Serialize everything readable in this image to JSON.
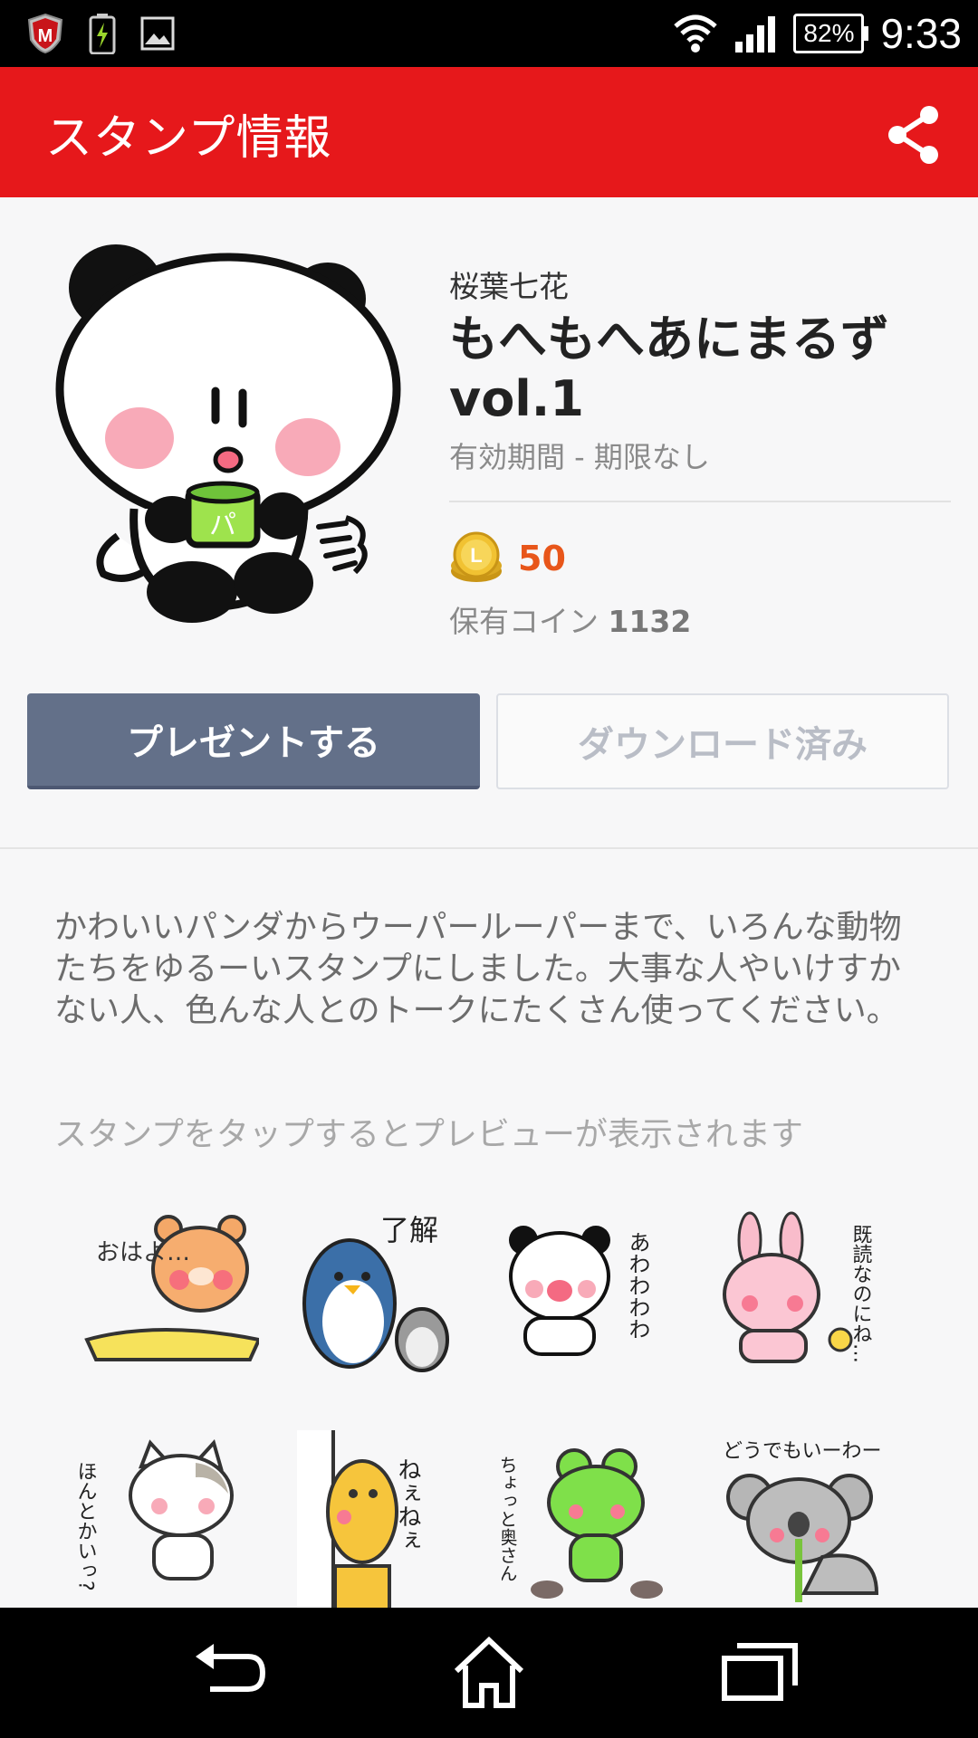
{
  "status_bar": {
    "battery": "82%",
    "time": "9:33"
  },
  "app_bar": {
    "title": "スタンプ情報",
    "share_icon": "share-icon"
  },
  "pack": {
    "author": "桜葉七花",
    "title": "もへもへあにまるずvol.1",
    "validity": "有効期間 - 期限なし",
    "price": "50",
    "owned_label": "保有コイン",
    "owned_coins": "1132"
  },
  "buttons": {
    "present": "プレゼントする",
    "download": "ダウンロード済み"
  },
  "description": "かわいいパンダからウーパールーパーまで、いろんな動物たちをゆるーいスタンプにしました。大事な人やいけすかない人、色んな人とのトークにたくさん使ってください。",
  "preview_hint": "スタンプをタップするとプレビューが表示されます",
  "stickers": [
    {
      "animal": "bear",
      "text": "おはよ…"
    },
    {
      "animal": "penguin",
      "text": "了解"
    },
    {
      "animal": "panda",
      "text": "あわわわわ"
    },
    {
      "animal": "rabbit",
      "text": "既読なのにね…"
    },
    {
      "animal": "cat",
      "text": "ほんとかいっ?"
    },
    {
      "animal": "giraffe",
      "text": "ねぇねぇ"
    },
    {
      "animal": "frog",
      "text": "ちょっと奥さん"
    },
    {
      "animal": "koala",
      "text": "どうでもいーわー"
    }
  ],
  "colors": {
    "accent_red": "#e6181b",
    "present_button": "#637089",
    "price_orange": "#e8561a"
  }
}
